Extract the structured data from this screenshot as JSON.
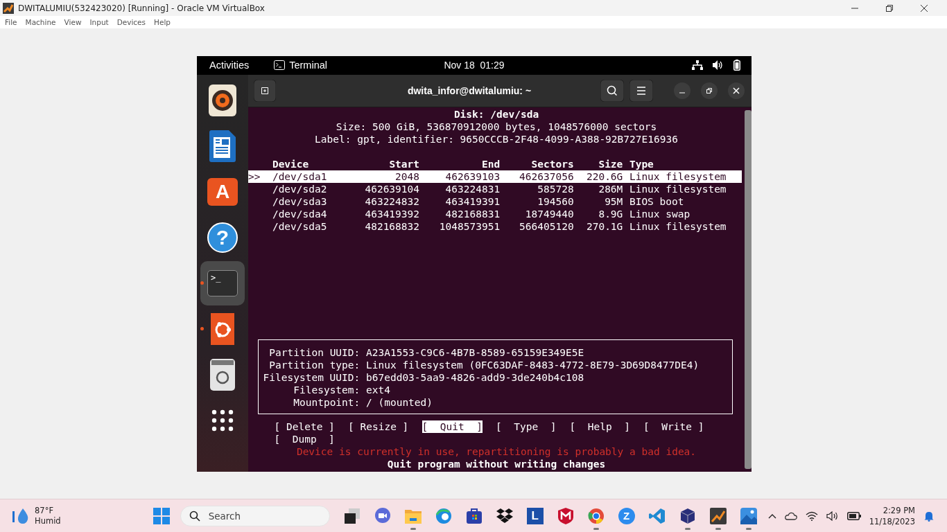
{
  "vbox_window": {
    "title": "DWITALUMIU(532423020) [Running] - Oracle VM VirtualBox"
  },
  "menu": [
    "File",
    "Machine",
    "View",
    "Input",
    "Devices",
    "Help"
  ],
  "gnome_topbar": {
    "activities": "Activities",
    "app": "Terminal",
    "clock": "Nov 18  01:29"
  },
  "dock": [
    {
      "kind": "speaker",
      "selected": false,
      "running": false
    },
    {
      "kind": "document",
      "selected": false,
      "running": false
    },
    {
      "kind": "store",
      "glyph": "A",
      "selected": false,
      "running": false
    },
    {
      "kind": "help",
      "glyph": "?",
      "selected": false,
      "running": false
    },
    {
      "kind": "terminal",
      "glyph": ">_",
      "selected": true,
      "running": true
    },
    {
      "kind": "ubuntu",
      "selected": false,
      "running": true
    },
    {
      "kind": "trash",
      "selected": false,
      "running": false
    },
    {
      "kind": "grid",
      "selected": false,
      "running": false
    }
  ],
  "terminal": {
    "title": "dwita_infor@dwitalumiu: ~",
    "disk_header": [
      "Disk: /dev/sda",
      "Size: 500 GiB, 536870912000 bytes, 1048576000 sectors",
      "Label: gpt, identifier: 9650CCCB-2F48-4099-A388-92B727E16936"
    ],
    "cursor": ">>",
    "columns": [
      "Device",
      "Start",
      "End",
      "Sectors",
      "Size",
      "Type"
    ],
    "rows": [
      {
        "device": "/dev/sda1",
        "start": "2048",
        "end": "462639103",
        "sectors": "462637056",
        "size": "220.6G",
        "type": "Linux filesystem",
        "selected": true
      },
      {
        "device": "/dev/sda2",
        "start": "462639104",
        "end": "463224831",
        "sectors": "585728",
        "size": "286M",
        "type": "Linux filesystem",
        "selected": false
      },
      {
        "device": "/dev/sda3",
        "start": "463224832",
        "end": "463419391",
        "sectors": "194560",
        "size": "95M",
        "type": "BIOS boot",
        "selected": false
      },
      {
        "device": "/dev/sda4",
        "start": "463419392",
        "end": "482168831",
        "sectors": "18749440",
        "size": "8.9G",
        "type": "Linux swap",
        "selected": false
      },
      {
        "device": "/dev/sda5",
        "start": "482168832",
        "end": "1048573951",
        "sectors": "566405120",
        "size": "270.1G",
        "type": "Linux filesystem",
        "selected": false
      }
    ],
    "info": [
      {
        "label": "Partition UUID:",
        "value": "A23A1553-C9C6-4B7B-8589-65159E349E5E"
      },
      {
        "label": "Partition type:",
        "value": "Linux filesystem (0FC63DAF-8483-4772-8E79-3D69D8477DE4)"
      },
      {
        "label": "Filesystem UUID:",
        "value": "b67edd03-5aa9-4826-add9-3de240b4c108"
      },
      {
        "label": "Filesystem:",
        "value": "ext4"
      },
      {
        "label": "Mountpoint:",
        "value": "/ (mounted)"
      }
    ],
    "actions": [
      {
        "label": "[ Delete ]",
        "selected": false
      },
      {
        "label": "[ Resize ]",
        "selected": false
      },
      {
        "label": "[  Quit  ]",
        "selected": true
      },
      {
        "label": "[  Type  ]",
        "selected": false
      },
      {
        "label": "[  Help  ]",
        "selected": false
      },
      {
        "label": "[  Write ]",
        "selected": false
      },
      {
        "label": "[  Dump  ]",
        "selected": false
      }
    ],
    "warning": "Device is currently in use, repartitioning is probably a bad idea.",
    "hint": "Quit program without writing changes"
  },
  "taskbar": {
    "weather": {
      "temp": "87°F",
      "condition": "Humid"
    },
    "search_placeholder": "Search",
    "apps": [
      {
        "kind": "task-view",
        "running": false
      },
      {
        "kind": "chat",
        "running": false
      },
      {
        "kind": "folder",
        "running": true
      },
      {
        "kind": "edge",
        "running": false
      },
      {
        "kind": "store",
        "running": false
      },
      {
        "kind": "dropbox",
        "running": false
      },
      {
        "kind": "letter",
        "glyph": "L",
        "running": false
      },
      {
        "kind": "shield",
        "running": false
      },
      {
        "kind": "chrome",
        "running": true
      },
      {
        "kind": "round-letter",
        "glyph": "Z",
        "running": false
      },
      {
        "kind": "code",
        "running": false
      },
      {
        "kind": "cube",
        "running": true
      },
      {
        "kind": "vbox",
        "running": true
      },
      {
        "kind": "photos",
        "running": true
      }
    ],
    "time": "2:29 PM",
    "date": "11/18/2023"
  }
}
